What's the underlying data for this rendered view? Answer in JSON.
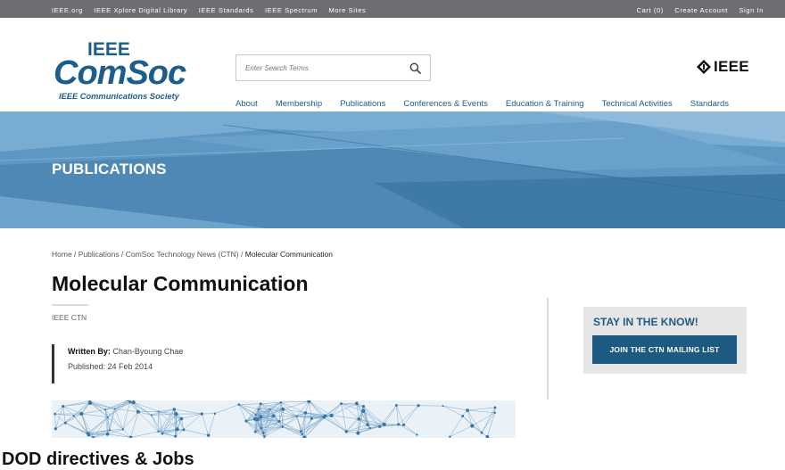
{
  "topbar": {
    "left_links": [
      "IEEE.org",
      "IEEE Xplore Digital Library",
      "IEEE Standards",
      "IEEE Spectrum",
      "More Sites"
    ],
    "right_links": [
      "Cart (0)",
      "Create Account",
      "Sign In"
    ]
  },
  "logo": {
    "line1": "IEEE",
    "line2": "ComSoc",
    "subtitle": "IEEE Communications Society",
    "color": "#1b5d8c"
  },
  "search": {
    "placeholder": "Enter Search Terms",
    "icon": "search-icon"
  },
  "ieee_brand": {
    "text": "IEEE",
    "icon": "ieee-diamond-icon"
  },
  "nav": [
    "About",
    "Membership",
    "Publications",
    "Conferences & Events",
    "Education & Training",
    "Technical Activities",
    "Standards"
  ],
  "hero": {
    "title": "PUBLICATIONS",
    "color": "#5d95bf"
  },
  "breadcrumb": {
    "items": [
      "Home",
      "Publications",
      "ComSoc Technology News (CTN)"
    ],
    "current": "Molecular Communication",
    "separator": " / "
  },
  "article": {
    "title": "Molecular Communication",
    "tag": "IEEE CTN",
    "written_by_label": "Written By:",
    "author": "Chan-Byoung Chae",
    "published": "Published: 24 Feb 2014"
  },
  "sidebar": {
    "heading": "STAY IN THE KNOW!",
    "button_label": "JOIN THE CTN MAILING LIST",
    "accent": "#1c5a82"
  },
  "caption": "DOD directives & Jobs"
}
